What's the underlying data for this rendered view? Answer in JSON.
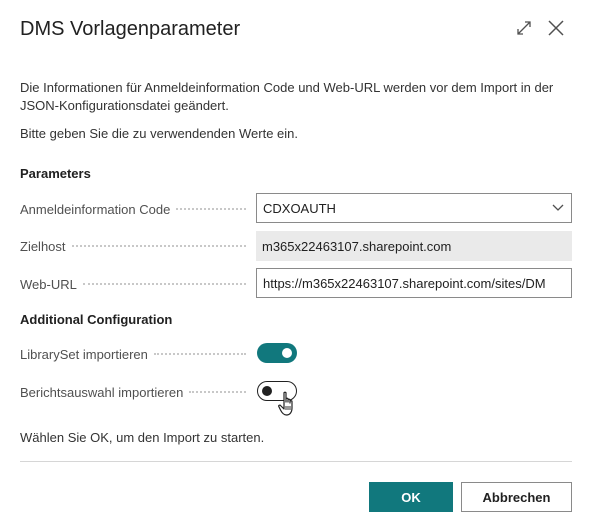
{
  "dialog": {
    "title": "DMS Vorlagenparameter",
    "icons": {
      "expand": "expand-icon",
      "close": "close-icon"
    }
  },
  "description": {
    "line1": "Die Informationen für Anmeldeinformation Code und Web-URL werden vor dem Import in der JSON-Konfigurationsdatei geändert.",
    "line2": "Bitte geben Sie die zu verwendenden Werte ein."
  },
  "parameters": {
    "heading": "Parameters",
    "credential_code": {
      "label": "Anmeldeinformation Code",
      "value": "CDXOAUTH"
    },
    "target_host": {
      "label": "Zielhost",
      "value": "m365x22463107.sharepoint.com"
    },
    "web_url": {
      "label": "Web-URL",
      "value": "https://m365x22463107.sharepoint.com/sites/DM"
    }
  },
  "additional": {
    "heading": "Additional Configuration",
    "library_set": {
      "label": "LibrarySet importieren",
      "enabled": true
    },
    "report_selection": {
      "label": "Berichtsauswahl importieren",
      "enabled": false
    }
  },
  "footer": {
    "hint": "Wählen Sie OK, um den Import zu starten.",
    "ok_label": "OK",
    "cancel_label": "Abbrechen"
  },
  "colors": {
    "accent": "#11787d",
    "readonly_bg": "#eaeaea"
  }
}
